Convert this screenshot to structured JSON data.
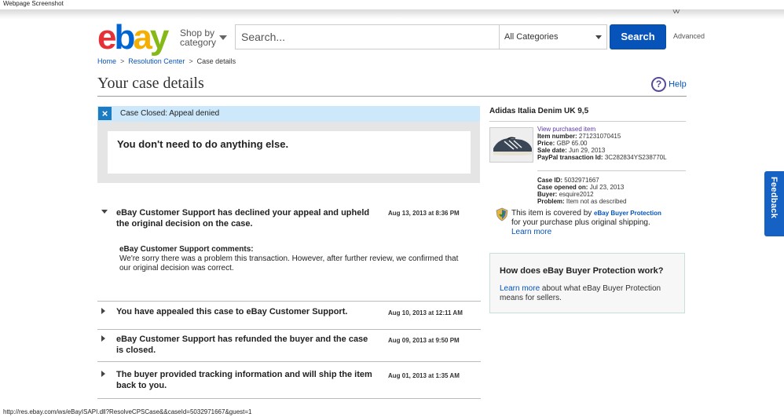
{
  "window": {
    "title": "Webpage Screenshot",
    "more": "˅˅"
  },
  "header": {
    "logo": [
      "e",
      "b",
      "a",
      "y"
    ],
    "shop_by_line1": "Shop by",
    "shop_by_line2": "category",
    "search_placeholder": "Search...",
    "category_selected": "All Categories",
    "search_button": "Search",
    "advanced": "Advanced"
  },
  "breadcrumb": {
    "home": "Home",
    "sep": ">",
    "resolution": "Resolution Center",
    "current": "Case details"
  },
  "page": {
    "title": "Your case details",
    "help_icon": "?",
    "help": "Help"
  },
  "status": {
    "icon": "×",
    "label": "Case Closed: Appeal denied",
    "message": "You don't need to do anything else."
  },
  "events": [
    {
      "title": "eBay Customer Support has declined your appeal and upheld the original decision on the case.",
      "date": "Aug 13, 2013 at 8:36 PM",
      "comments_heading": "eBay Customer Support comments:",
      "comments_text": "We're sorry there was a problem this transaction. However, after further review, we confirmed that our original decision was correct."
    },
    {
      "title": "You have appealed this case to eBay Customer Support.",
      "date": "Aug 10, 2013 at 12:11 AM"
    },
    {
      "title": "eBay Customer Support has refunded the buyer and the case is closed.",
      "date": "Aug 09, 2013 at 9:50 PM"
    },
    {
      "title": "The buyer provided tracking information and will ship the item back to you.",
      "date": "Aug 01, 2013 at 1:35 AM"
    }
  ],
  "item": {
    "title": "Adidas Italia Denim UK 9,5",
    "view_link": "View purchased item",
    "item_number_label": "Item number:",
    "item_number": "271231070415",
    "price_label": "Price:",
    "price": "GBP 65.00",
    "sale_date_label": "Sale date:",
    "sale_date": "Jun 29, 2013",
    "paypal_label": "PayPal transaction Id:",
    "paypal_id": "3C282834YS238770L",
    "case_id_label": "Case ID:",
    "case_id": "5032971667",
    "case_opened_label": "Case opened on:",
    "case_opened": "Jul 23, 2013",
    "buyer_label": "Buyer:",
    "buyer": "esquire2012",
    "problem_label": "Problem:",
    "problem": "Item not as described"
  },
  "protection": {
    "line1": "This item is covered by",
    "brand": "eBay Buyer Protection",
    "line2": "for your purchase plus original shipping.",
    "learn_more": "Learn more"
  },
  "bp_box": {
    "heading": "How does eBay Buyer Protection work?",
    "link": "Learn more",
    "text": "about what eBay Buyer Protection means for sellers."
  },
  "feedback": "Feedback",
  "status_url": "http://res.ebay.com/ws/eBayISAPI.dll?ResolveCPSCase&&caseId=5032971667&guest=1"
}
